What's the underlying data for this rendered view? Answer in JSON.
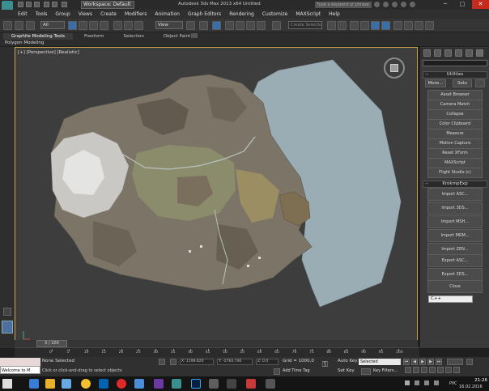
{
  "titlebar": {
    "workspace": "Workspace: Default",
    "title": "Autodesk 3ds Max 2013 x64    Untitled",
    "search_placeholder": "Type a keyword or phrase"
  },
  "menu": [
    "Edit",
    "Tools",
    "Group",
    "Views",
    "Create",
    "Modifiers",
    "Animation",
    "Graph Editors",
    "Rendering",
    "Customize",
    "MAXScript",
    "Help"
  ],
  "toolbar": {
    "filter": "All",
    "ref_coord": "View",
    "named_selection": "Create Selection Se"
  },
  "ribbon": {
    "tabs": [
      "Graphite Modeling Tools",
      "Freeform",
      "Selection",
      "Object Paint"
    ],
    "sub": "Polygon Modeling"
  },
  "viewport": {
    "label": "[+] [Perspective] [Realistic]",
    "ocean_color": "#9aacb4"
  },
  "command_panel": {
    "utilities_title": "Utilities",
    "more": "More...",
    "sets": "Sets",
    "utilities": [
      "Asset Browser",
      "Camera Match",
      "Collapse",
      "Color Clipboard",
      "Measure",
      "Motion Capture",
      "Reset XForm",
      "MAXScript",
      "Flight Studio (c)"
    ],
    "exp_title": "KrokmpExp",
    "exp_buttons": [
      "Import ASC...",
      "Import 3DS...",
      "Import MSH...",
      "Import MRM...",
      "Import ZEN...",
      "Export ASC...",
      "Export 3DS...",
      "Close"
    ],
    "language": "C++"
  },
  "timeline": {
    "frame": "0 / 100",
    "ticks": [
      "0",
      "5",
      "10",
      "15",
      "20",
      "25",
      "30",
      "35",
      "40",
      "45",
      "50",
      "55",
      "60",
      "65",
      "70",
      "75",
      "80",
      "85",
      "90",
      "95",
      "100"
    ]
  },
  "status": {
    "maxscript_line1": "",
    "maxscript_line2": "Welcome to M",
    "selection": "None Selected",
    "prompt": "Click or click-and-drag to select objects",
    "x": "X: 1198.820",
    "y": "Y: -2764.746",
    "z": "Z: 0.0",
    "grid": "Grid = 1000,0",
    "add_time_tag": "Add Time Tag",
    "auto_key": "Auto Key",
    "set_key": "Set Key",
    "selected": "Selected",
    "key_filters": "Key Filters..."
  },
  "taskbar": {
    "lang": "РУС",
    "time": "21:26",
    "date": "16.02.2016"
  }
}
